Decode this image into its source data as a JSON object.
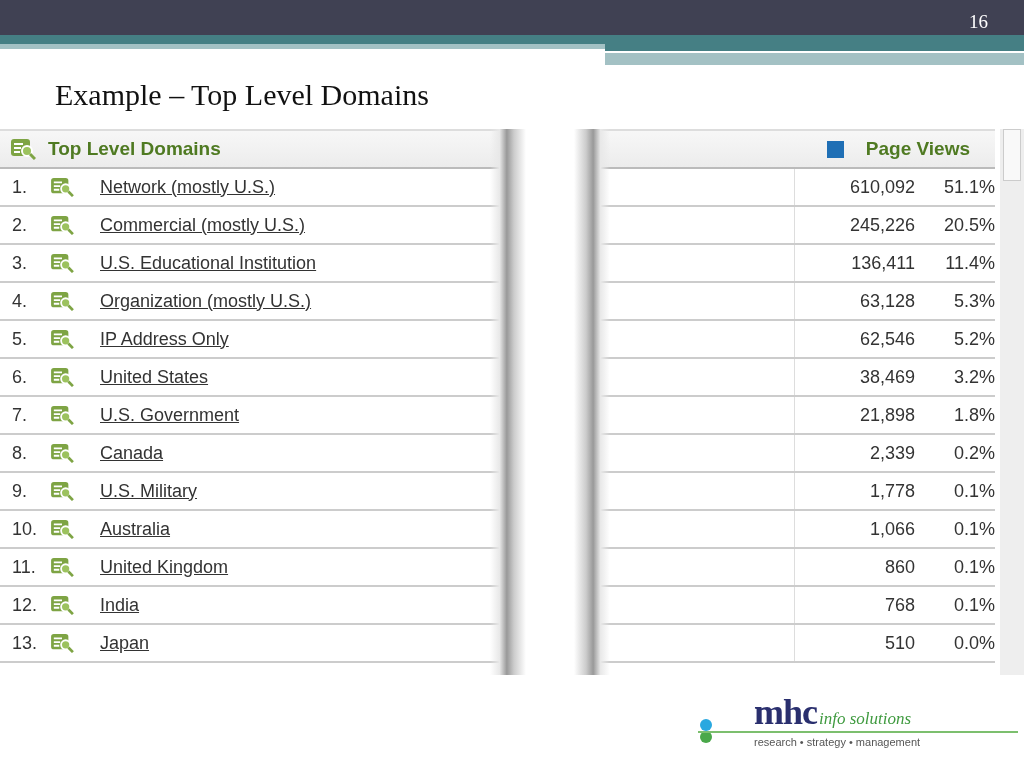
{
  "slide": {
    "number": "16",
    "title": "Example – Top Level Domains"
  },
  "report": {
    "title": "Top Level Domains",
    "metric_header": "Page Views",
    "rows": [
      {
        "rank": "1.",
        "name": "Network (mostly U.S.)",
        "count": "610,092",
        "percent": "51.1%"
      },
      {
        "rank": "2.",
        "name": "Commercial (mostly U.S.)",
        "count": "245,226",
        "percent": "20.5%"
      },
      {
        "rank": "3.",
        "name": "U.S. Educational Institution",
        "count": "136,411",
        "percent": "11.4%"
      },
      {
        "rank": "4.",
        "name": "Organization (mostly U.S.)",
        "count": "63,128",
        "percent": "5.3%"
      },
      {
        "rank": "5.",
        "name": "IP Address Only",
        "count": "62,546",
        "percent": "5.2%"
      },
      {
        "rank": "6.",
        "name": "United States",
        "count": "38,469",
        "percent": "3.2%"
      },
      {
        "rank": "7.",
        "name": "U.S. Government",
        "count": "21,898",
        "percent": "1.8%"
      },
      {
        "rank": "8.",
        "name": "Canada",
        "count": "2,339",
        "percent": "0.2%"
      },
      {
        "rank": "9.",
        "name": "U.S. Military",
        "count": "1,778",
        "percent": "0.1%"
      },
      {
        "rank": "10.",
        "name": "Australia",
        "count": "1,066",
        "percent": "0.1%"
      },
      {
        "rank": "11.",
        "name": "United Kingdom",
        "count": "860",
        "percent": "0.1%"
      },
      {
        "rank": "12.",
        "name": "India",
        "count": "768",
        "percent": "0.1%"
      },
      {
        "rank": "13.",
        "name": "Japan",
        "count": "510",
        "percent": "0.0%"
      }
    ]
  },
  "logo": {
    "brand": "mhc",
    "tagline": "info solutions",
    "motto": "research • strategy • management"
  }
}
